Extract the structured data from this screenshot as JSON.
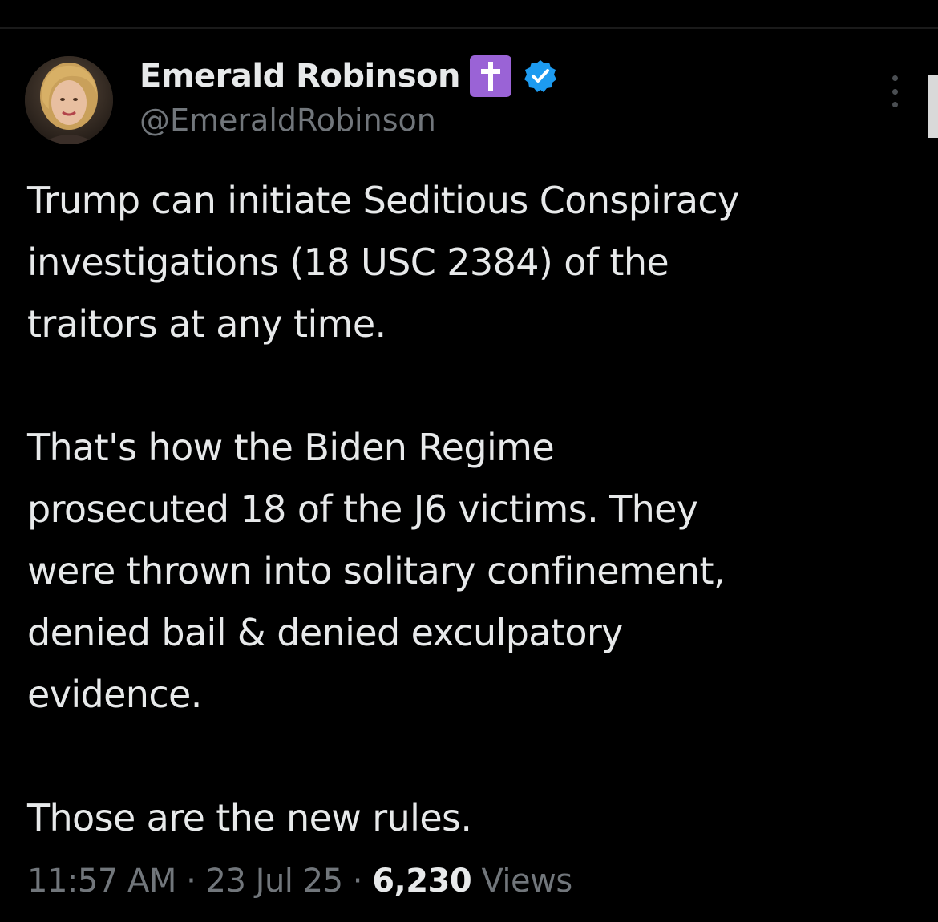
{
  "author": {
    "display_name": "Emerald Robinson",
    "emoji_icon": "latin-cross",
    "verified_icon": "verified-badge",
    "handle": "@EmeraldRobinson"
  },
  "tweet": {
    "paragraphs": [
      {
        "lines": [
          "Trump can initiate Seditious Conspiracy",
          "investigations (18 USC 2384) of the",
          "traitors at any time."
        ]
      },
      {
        "lines": [
          "That's how the Biden Regime",
          "prosecuted 18 of the J6 victims. They",
          "were thrown into solitary confinement,",
          "denied bail & denied exculpatory",
          "evidence."
        ]
      },
      {
        "lines": [
          "Those are the new rules."
        ]
      }
    ]
  },
  "meta": {
    "time": "11:57 AM",
    "separator": "·",
    "date": "23 Jul 25",
    "views_count": "6,230",
    "views_label": "Views"
  },
  "colors": {
    "background": "#000000",
    "text_primary": "#e7e9ea",
    "text_secondary": "#71767b",
    "verified_blue": "#1d9bf0",
    "emoji_purple": "#9a63d6"
  }
}
